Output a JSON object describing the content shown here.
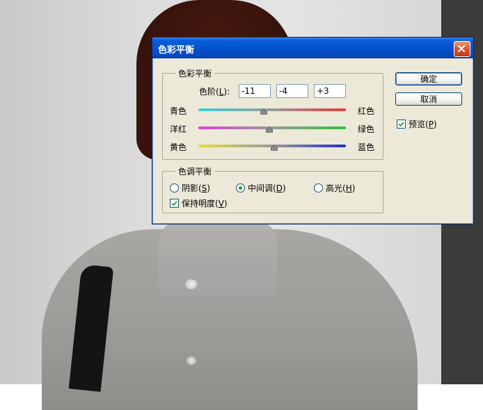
{
  "dialog": {
    "title": "色彩平衡"
  },
  "color_balance": {
    "group_label": "色彩平衡",
    "levels_label_pre": "色阶(",
    "levels_label_key": "L",
    "levels_label_post": "):",
    "level1": "-11",
    "level2": "-4",
    "level3": "+3",
    "sliders": [
      {
        "left": "青色",
        "right": "红色",
        "value": -11,
        "colors": [
          "#3ad0d8",
          "#e0403a"
        ]
      },
      {
        "left": "洋红",
        "right": "绿色",
        "value": -4,
        "colors": [
          "#e040d8",
          "#30c040"
        ]
      },
      {
        "left": "黄色",
        "right": "蓝色",
        "value": 3,
        "colors": [
          "#e0e040",
          "#2030d0"
        ]
      }
    ],
    "slider_range": [
      -100,
      100
    ]
  },
  "tone_balance": {
    "group_label": "色调平衡",
    "shadows": {
      "pre": "阴影(",
      "key": "S",
      "post": ")",
      "selected": false
    },
    "midtones": {
      "pre": "中间调(",
      "key": "D",
      "post": ")",
      "selected": true
    },
    "highlights": {
      "pre": "高光(",
      "key": "H",
      "post": ")",
      "selected": false
    },
    "preserve": {
      "pre": "保持明度(",
      "key": "V",
      "post": ")",
      "checked": true
    }
  },
  "buttons": {
    "ok": "确定",
    "cancel": "取消"
  },
  "preview": {
    "pre": "预览(",
    "key": "P",
    "post": ")",
    "checked": true
  },
  "colors": {
    "titlebar": "#0551cf",
    "dialog_bg": "#ece9d8",
    "check_mark": "#21a121",
    "close": "#d8572b"
  }
}
